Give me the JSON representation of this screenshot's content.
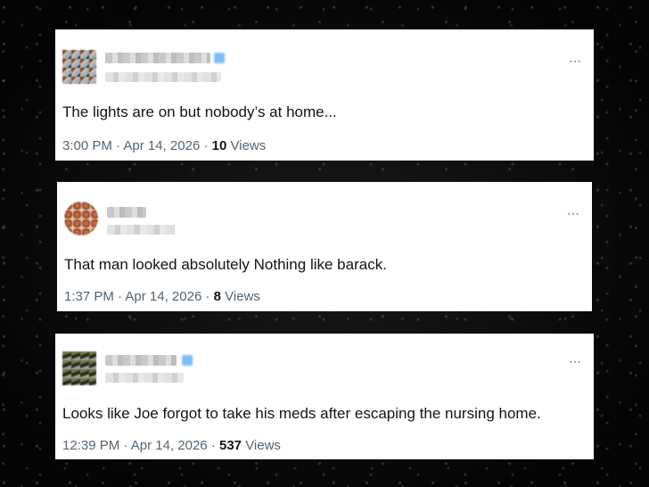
{
  "more_icon": "⋯",
  "tweets": [
    {
      "text": "The lights are on but nobody’s at home...",
      "time": "3:00 PM",
      "date": "Apr 14, 2026",
      "separator": "·",
      "views_count": "10",
      "views_label": "Views"
    },
    {
      "text": "That man looked absolutely Nothing like barack.",
      "time": "1:37 PM",
      "date": "Apr 14, 2026",
      "separator": "·",
      "views_count": "8",
      "views_label": "Views"
    },
    {
      "text": "Looks like Joe forgot to take his meds after escaping the nursing home.",
      "time": "12:39 PM",
      "date": "Apr 14, 2026",
      "separator": "·",
      "views_count": "537",
      "views_label": "Views"
    }
  ]
}
